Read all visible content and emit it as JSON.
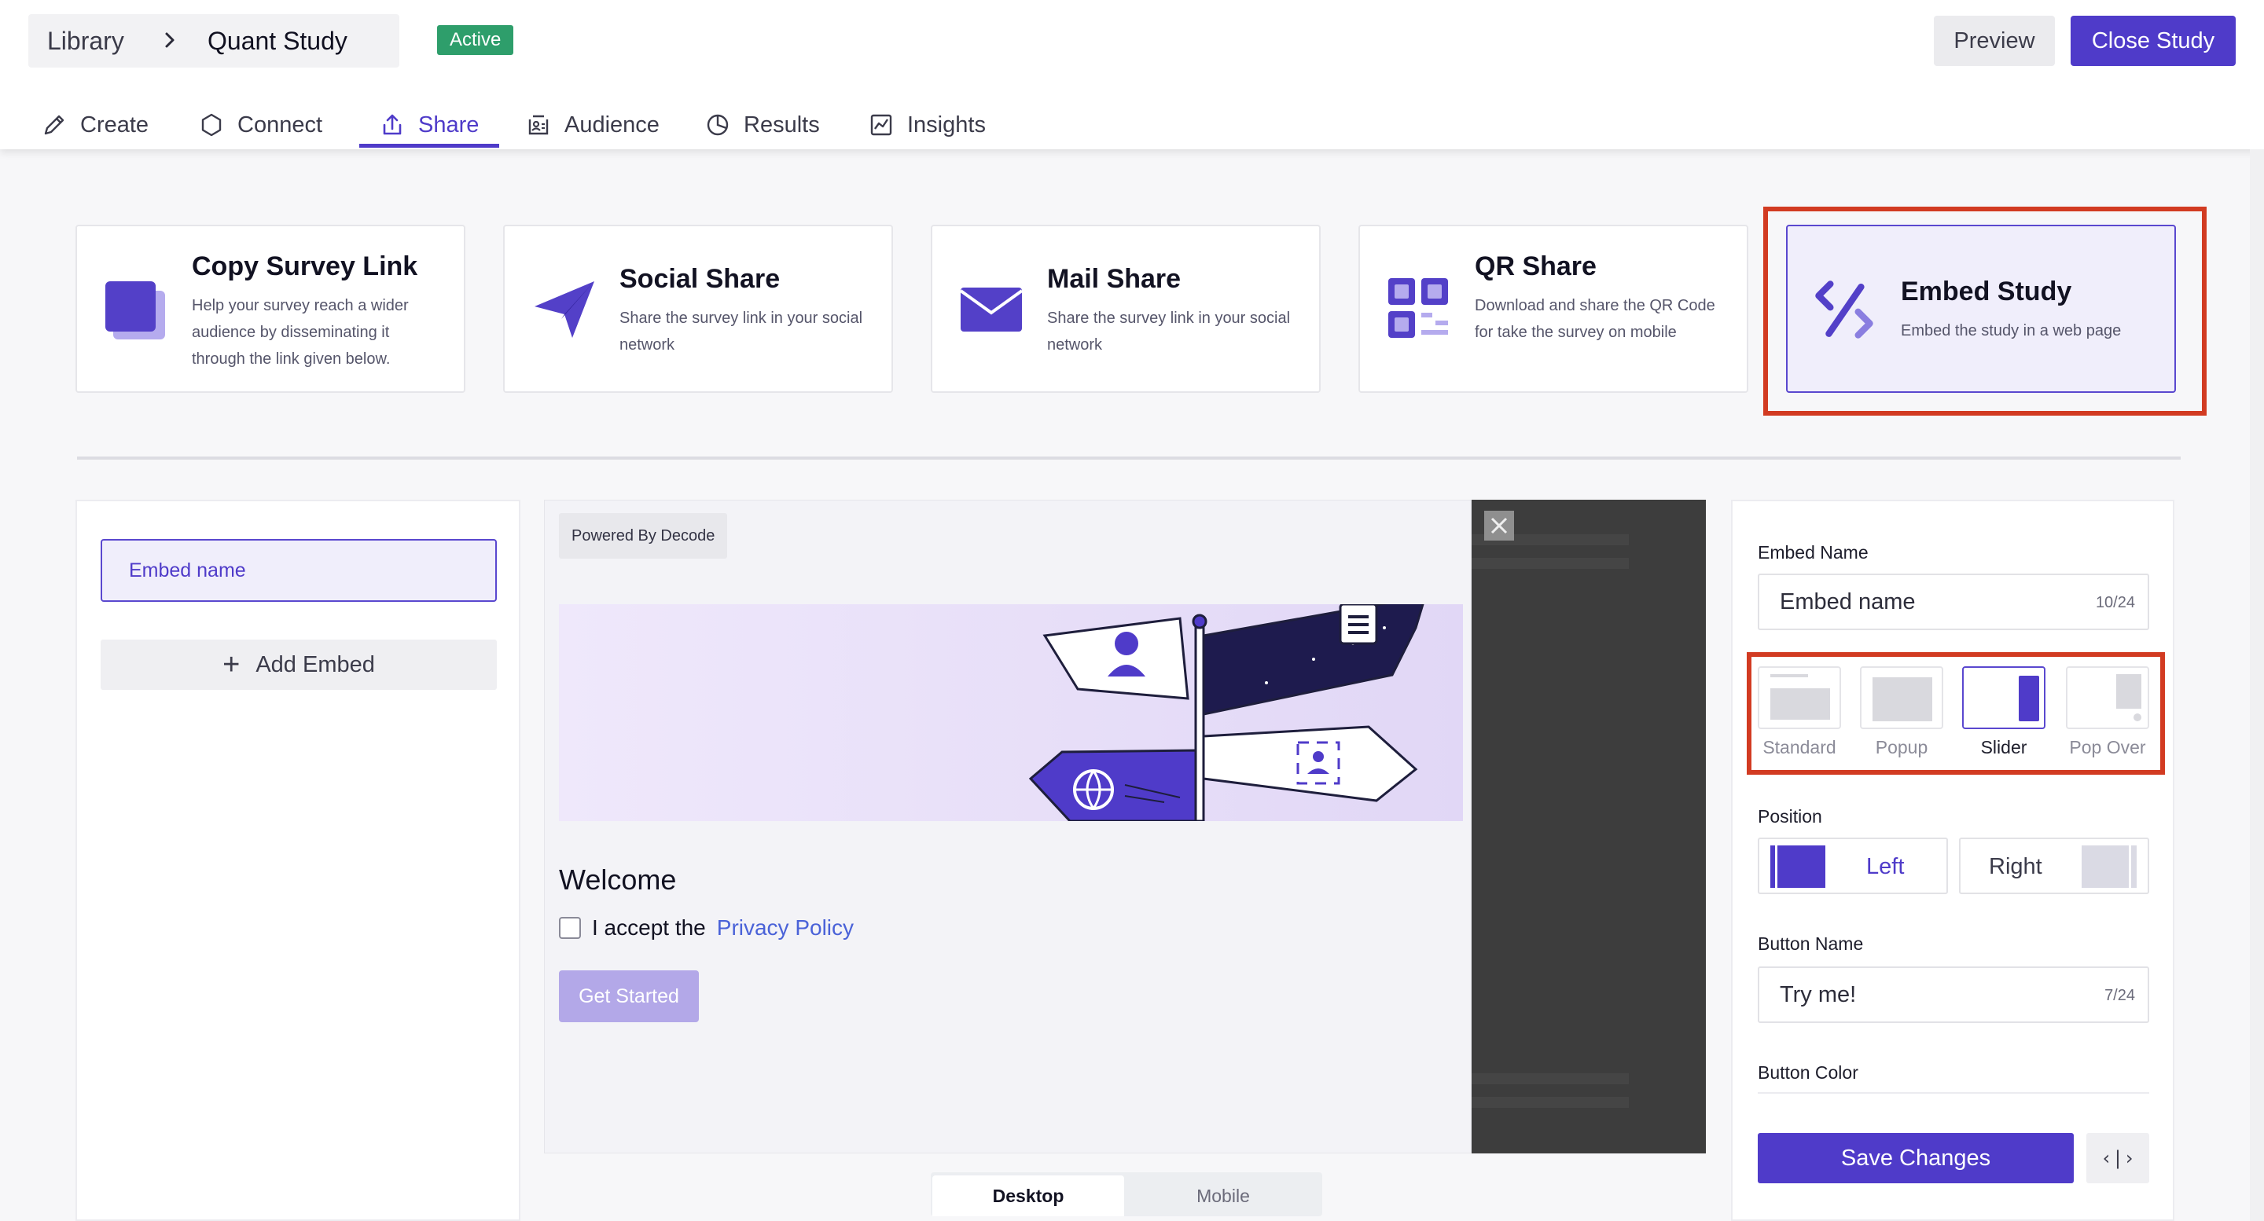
{
  "header": {
    "breadcrumb": {
      "root": "Library",
      "current": "Quant Study"
    },
    "status": "Active",
    "preview_label": "Preview",
    "close_label": "Close Study",
    "colors": {
      "accent": "#4f3bc9",
      "status": "#2e9e6b"
    }
  },
  "tabs": [
    {
      "label": "Create",
      "icon": "pencil-icon"
    },
    {
      "label": "Connect",
      "icon": "hexagon-icon"
    },
    {
      "label": "Share",
      "icon": "upload-icon",
      "active": true
    },
    {
      "label": "Audience",
      "icon": "audience-icon"
    },
    {
      "label": "Results",
      "icon": "pie-chart-icon"
    },
    {
      "label": "Insights",
      "icon": "line-chart-icon"
    }
  ],
  "share_options": [
    {
      "title": "Copy Survey Link",
      "desc": "Help your survey reach a wider audience by disseminating it through the link given below.",
      "icon": "copy-icon"
    },
    {
      "title": "Social Share",
      "desc": "Share the survey link in your social network",
      "icon": "paper-plane-icon"
    },
    {
      "title": "Mail Share",
      "desc": "Share the survey link in your social network",
      "icon": "mail-icon"
    },
    {
      "title": "QR Share",
      "desc": "Download and share the QR Code for take the survey on mobile",
      "icon": "qr-icon"
    },
    {
      "title": "Embed Study",
      "desc": "Embed the study in a web page",
      "icon": "code-embed-icon",
      "selected": true
    }
  ],
  "embeds": {
    "items": [
      "Embed name"
    ],
    "add_label": "Add Embed"
  },
  "preview": {
    "powered_by": "Powered By Decode",
    "welcome": "Welcome",
    "accept_text": "I accept the",
    "privacy_link": "Privacy Policy",
    "cta": "Get Started",
    "device_tabs": {
      "desktop": "Desktop",
      "mobile": "Mobile",
      "selected": "Desktop"
    }
  },
  "settings": {
    "embed_name_label": "Embed Name",
    "embed_name_value": "Embed name",
    "embed_name_counter": "10/24",
    "types": [
      {
        "label": "Standard"
      },
      {
        "label": "Popup"
      },
      {
        "label": "Slider",
        "selected": true
      },
      {
        "label": "Pop Over"
      }
    ],
    "position_label": "Position",
    "position_left": "Left",
    "position_right": "Right",
    "position_selected": "Left",
    "button_name_label": "Button Name",
    "button_name_value": "Try me!",
    "button_name_counter": "7/24",
    "button_color_label": "Button Color",
    "save_label": "Save Changes",
    "code_label": "‹|›"
  }
}
